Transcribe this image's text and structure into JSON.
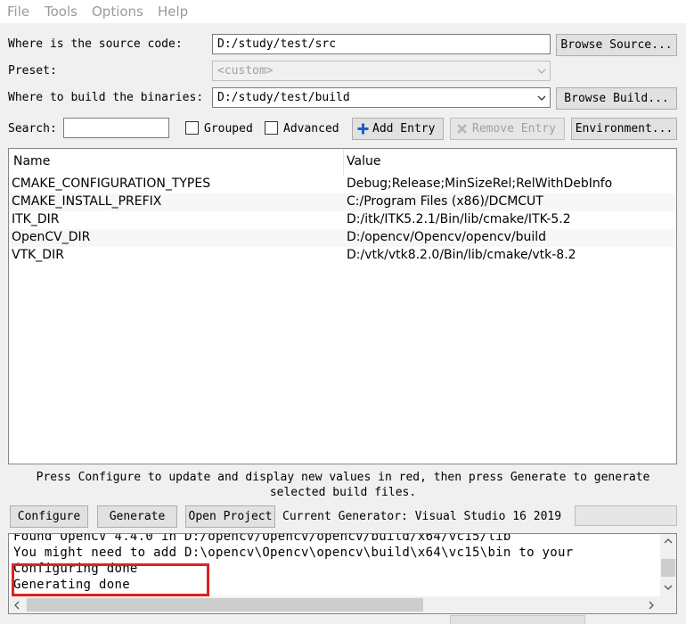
{
  "menu": {
    "items": [
      "File",
      "Tools",
      "Options",
      "Help"
    ]
  },
  "source": {
    "label": "Where is the source code:",
    "value": "D:/study/test/src",
    "browse_label": "Browse Source..."
  },
  "preset": {
    "label": "Preset:",
    "value": "<custom>"
  },
  "build": {
    "label": "Where to build the binaries:",
    "value": "D:/study/test/build",
    "browse_label": "Browse Build..."
  },
  "search": {
    "label": "Search:",
    "value": ""
  },
  "options": {
    "grouped_label": "Grouped",
    "advanced_label": "Advanced",
    "add_entry_label": "Add Entry",
    "remove_entry_label": "Remove Entry",
    "environment_label": "Environment..."
  },
  "table": {
    "columns": [
      "Name",
      "Value"
    ],
    "rows": [
      {
        "name": "CMAKE_CONFIGURATION_TYPES",
        "value": "Debug;Release;MinSizeRel;RelWithDebInfo"
      },
      {
        "name": "CMAKE_INSTALL_PREFIX",
        "value": "C:/Program Files (x86)/DCMCUT"
      },
      {
        "name": "ITK_DIR",
        "value": "D:/itk/ITK5.2.1/Bin/lib/cmake/ITK-5.2"
      },
      {
        "name": "OpenCV_DIR",
        "value": "D:/opencv/Opencv/opencv/build"
      },
      {
        "name": "VTK_DIR",
        "value": "D:/vtk/vtk8.2.0/Bin/lib/cmake/vtk-8.2"
      }
    ]
  },
  "hint": {
    "line1": "Press Configure to update and display new values in red, then press Generate to generate",
    "line2": "selected build files."
  },
  "actions": {
    "configure_label": "Configure",
    "generate_label": "Generate",
    "open_project_label": "Open Project",
    "generator_text": "Current Generator: Visual Studio 16 2019"
  },
  "output": {
    "lines": [
      "Found OpenCV 4.4.0 in D:/opencv/Opencv/opencv/build/x64/vc15/lib",
      "You might need to add D:\\opencv\\Opencv\\opencv\\build\\x64\\vc15\\bin to your",
      "Configuring done",
      "Generating done"
    ]
  },
  "colors": {
    "highlight": "#e02020",
    "add_icon": "#1c5fc7"
  }
}
